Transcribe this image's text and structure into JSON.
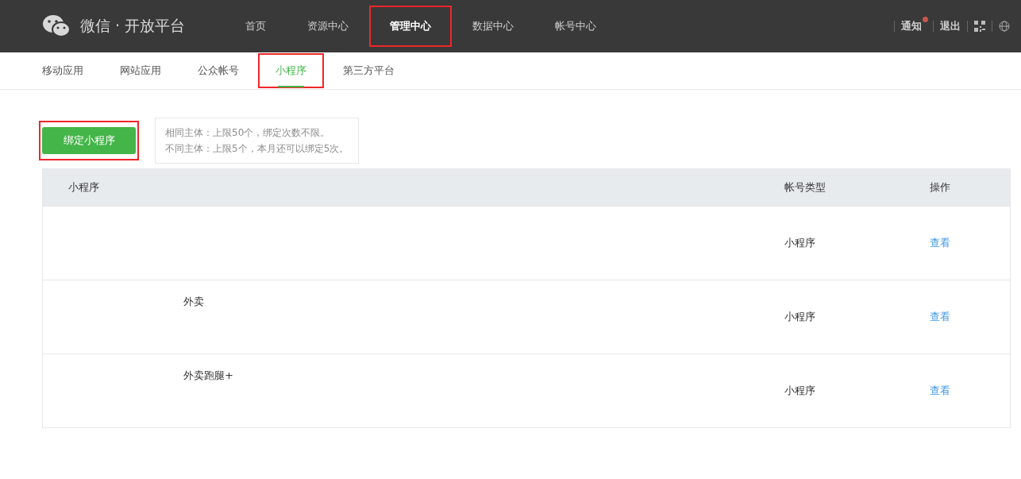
{
  "header": {
    "brand": "微信 · 开放平台",
    "nav": [
      {
        "label": "首页",
        "selected": false,
        "highlighted": false
      },
      {
        "label": "资源中心",
        "selected": false,
        "highlighted": false
      },
      {
        "label": "管理中心",
        "selected": true,
        "highlighted": true
      },
      {
        "label": "数据中心",
        "selected": false,
        "highlighted": false
      },
      {
        "label": "帐号中心",
        "selected": false,
        "highlighted": false
      }
    ],
    "notify": {
      "label": "通知",
      "unread": true
    },
    "logout": "退出"
  },
  "tabs": [
    {
      "label": "移动应用",
      "selected": false,
      "highlighted": false
    },
    {
      "label": "网站应用",
      "selected": false,
      "highlighted": false
    },
    {
      "label": "公众帐号",
      "selected": false,
      "highlighted": false
    },
    {
      "label": "小程序",
      "selected": true,
      "highlighted": true
    },
    {
      "label": "第三方平台",
      "selected": false,
      "highlighted": false
    }
  ],
  "bind_button": {
    "label": "绑定小程序",
    "highlighted": true
  },
  "tip": [
    "相同主体：上限50个，绑定次数不限。",
    "不同主体：上限5个，本月还可以绑定5次。"
  ],
  "table": {
    "columns": [
      "小程序",
      "帐号类型",
      "操作"
    ],
    "rows": [
      {
        "name": "",
        "type": "小程序",
        "action": "查看"
      },
      {
        "name": "外卖",
        "type": "小程序",
        "action": "查看"
      },
      {
        "name": "外卖跑腿+",
        "type": "小程序",
        "action": "查看"
      }
    ]
  }
}
